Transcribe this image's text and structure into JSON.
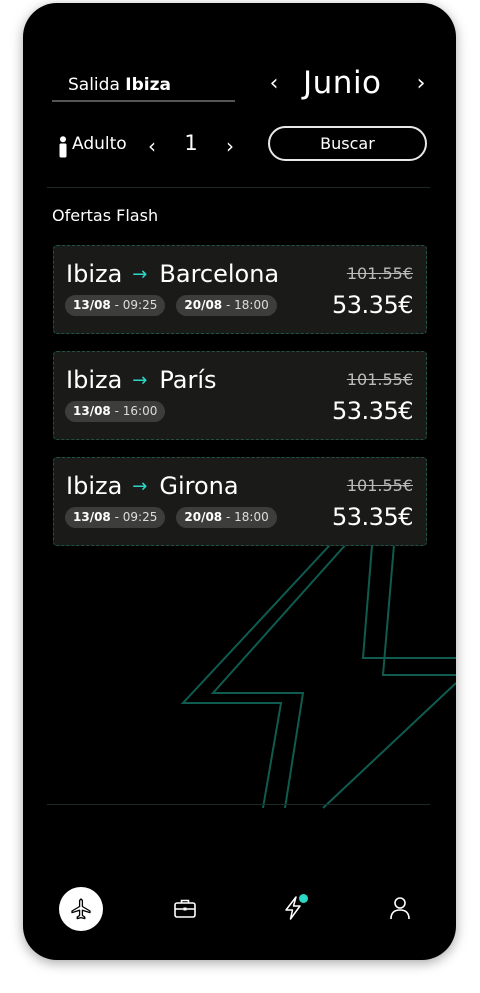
{
  "header": {
    "salida_label": "Salida",
    "salida_city": "Ibiza",
    "month": "Junio",
    "month_prev": "‹",
    "month_next": "›"
  },
  "passengers": {
    "type_label": "Adulto",
    "count": "1",
    "prev": "‹",
    "next": "›"
  },
  "search_button": "Buscar",
  "section_title": "Ofertas Flash",
  "offers": [
    {
      "from": "Ibiza",
      "to": "Barcelona",
      "old_price": "101.55€",
      "price": "53.35€",
      "dates": [
        {
          "date": "13/08",
          "time": "09:25"
        },
        {
          "date": "20/08",
          "time": "18:00"
        }
      ]
    },
    {
      "from": "Ibiza",
      "to": "París",
      "old_price": "101.55€",
      "price": "53.35€",
      "dates": [
        {
          "date": "13/08",
          "time": "16:00"
        }
      ]
    },
    {
      "from": "Ibiza",
      "to": "Girona",
      "old_price": "101.55€",
      "price": "53.35€",
      "dates": [
        {
          "date": "13/08",
          "time": "09:25"
        },
        {
          "date": "20/08",
          "time": "18:00"
        }
      ]
    }
  ],
  "route_arrow": "→",
  "date_separator": "-",
  "nav": {
    "items": [
      "plane-icon",
      "briefcase-icon",
      "lightning-icon",
      "user-icon"
    ],
    "active": "plane-icon",
    "accent": "#2bd8c6"
  },
  "colors": {
    "background": "#000000",
    "card": "#1a1b19",
    "accent": "#2bd8c6",
    "chip": "#3d3e3c"
  }
}
